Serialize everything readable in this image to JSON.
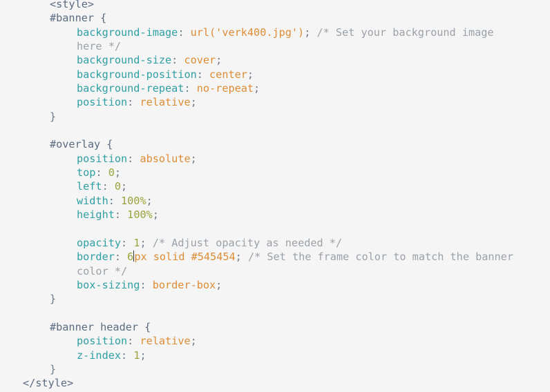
{
  "code": {
    "lines": [
      {
        "indent": "1",
        "tokens": [
          {
            "t": "tag",
            "v": "<style>"
          }
        ]
      },
      {
        "indent": "1",
        "tokens": [
          {
            "t": "sel",
            "v": "#banner {"
          }
        ]
      },
      {
        "indent": "2",
        "tokens": [
          {
            "t": "prop",
            "v": "background-image"
          },
          {
            "t": "punc",
            "v": ": "
          },
          {
            "t": "val-str",
            "v": "url('verk400.jpg')"
          },
          {
            "t": "punc",
            "v": "; "
          },
          {
            "t": "comment",
            "v": "/* Set your background image"
          }
        ]
      },
      {
        "indent": "2",
        "tokens": [
          {
            "t": "comment",
            "v": "here */"
          }
        ]
      },
      {
        "indent": "2",
        "tokens": [
          {
            "t": "prop",
            "v": "background-size"
          },
          {
            "t": "punc",
            "v": ": "
          },
          {
            "t": "val-kw",
            "v": "cover"
          },
          {
            "t": "punc",
            "v": ";"
          }
        ]
      },
      {
        "indent": "2",
        "tokens": [
          {
            "t": "prop",
            "v": "background-position"
          },
          {
            "t": "punc",
            "v": ": "
          },
          {
            "t": "val-kw",
            "v": "center"
          },
          {
            "t": "punc",
            "v": ";"
          }
        ]
      },
      {
        "indent": "2",
        "tokens": [
          {
            "t": "prop",
            "v": "background-repeat"
          },
          {
            "t": "punc",
            "v": ": "
          },
          {
            "t": "val-kw",
            "v": "no-repeat"
          },
          {
            "t": "punc",
            "v": ";"
          }
        ]
      },
      {
        "indent": "2",
        "tokens": [
          {
            "t": "prop",
            "v": "position"
          },
          {
            "t": "punc",
            "v": ": "
          },
          {
            "t": "val-kw",
            "v": "relative"
          },
          {
            "t": "punc",
            "v": ";"
          }
        ]
      },
      {
        "indent": "1",
        "tokens": [
          {
            "t": "punc",
            "v": "}"
          }
        ]
      },
      {
        "indent": "1",
        "tokens": []
      },
      {
        "indent": "1",
        "tokens": [
          {
            "t": "sel",
            "v": "#overlay {"
          }
        ]
      },
      {
        "indent": "2",
        "tokens": [
          {
            "t": "prop",
            "v": "position"
          },
          {
            "t": "punc",
            "v": ": "
          },
          {
            "t": "val-kw",
            "v": "absolute"
          },
          {
            "t": "punc",
            "v": ";"
          }
        ]
      },
      {
        "indent": "2",
        "tokens": [
          {
            "t": "prop",
            "v": "top"
          },
          {
            "t": "punc",
            "v": ": "
          },
          {
            "t": "val-num",
            "v": "0"
          },
          {
            "t": "punc",
            "v": ";"
          }
        ]
      },
      {
        "indent": "2",
        "tokens": [
          {
            "t": "prop",
            "v": "left"
          },
          {
            "t": "punc",
            "v": ": "
          },
          {
            "t": "val-num",
            "v": "0"
          },
          {
            "t": "punc",
            "v": ";"
          }
        ]
      },
      {
        "indent": "2",
        "tokens": [
          {
            "t": "prop",
            "v": "width"
          },
          {
            "t": "punc",
            "v": ": "
          },
          {
            "t": "val-num",
            "v": "100%"
          },
          {
            "t": "punc",
            "v": ";"
          }
        ]
      },
      {
        "indent": "2",
        "tokens": [
          {
            "t": "prop",
            "v": "height"
          },
          {
            "t": "punc",
            "v": ": "
          },
          {
            "t": "val-num",
            "v": "100%"
          },
          {
            "t": "punc",
            "v": ";"
          }
        ]
      },
      {
        "indent": "2",
        "tokens": []
      },
      {
        "indent": "2",
        "tokens": [
          {
            "t": "prop",
            "v": "opacity"
          },
          {
            "t": "punc",
            "v": ": "
          },
          {
            "t": "val-num",
            "v": "1"
          },
          {
            "t": "punc",
            "v": "; "
          },
          {
            "t": "comment",
            "v": "/* Adjust opacity as needed */"
          }
        ]
      },
      {
        "indent": "2",
        "tokens": [
          {
            "t": "prop",
            "v": "border"
          },
          {
            "t": "punc",
            "v": ": "
          },
          {
            "t": "val-num",
            "v": "6"
          },
          {
            "t": "cursor",
            "v": ""
          },
          {
            "t": "val-unit",
            "v": "px solid #545454"
          },
          {
            "t": "punc",
            "v": "; "
          },
          {
            "t": "comment",
            "v": "/* Set the frame color to match the banner"
          }
        ]
      },
      {
        "indent": "2",
        "tokens": [
          {
            "t": "comment",
            "v": "color */"
          }
        ]
      },
      {
        "indent": "2",
        "tokens": [
          {
            "t": "prop",
            "v": "box-sizing"
          },
          {
            "t": "punc",
            "v": ": "
          },
          {
            "t": "val-kw",
            "v": "border-box"
          },
          {
            "t": "punc",
            "v": ";"
          }
        ]
      },
      {
        "indent": "1",
        "tokens": [
          {
            "t": "punc",
            "v": "}"
          }
        ]
      },
      {
        "indent": "1",
        "tokens": []
      },
      {
        "indent": "1",
        "tokens": [
          {
            "t": "sel",
            "v": "#banner header {"
          }
        ]
      },
      {
        "indent": "2",
        "tokens": [
          {
            "t": "prop",
            "v": "position"
          },
          {
            "t": "punc",
            "v": ": "
          },
          {
            "t": "val-kw",
            "v": "relative"
          },
          {
            "t": "punc",
            "v": ";"
          }
        ]
      },
      {
        "indent": "2",
        "tokens": [
          {
            "t": "prop",
            "v": "z-index"
          },
          {
            "t": "punc",
            "v": ": "
          },
          {
            "t": "val-num",
            "v": "1"
          },
          {
            "t": "punc",
            "v": ";"
          }
        ]
      },
      {
        "indent": "1",
        "tokens": [
          {
            "t": "punc",
            "v": "}"
          }
        ]
      },
      {
        "indent": "0",
        "tokens": [
          {
            "t": "tag",
            "v": "</style>"
          }
        ]
      }
    ]
  }
}
